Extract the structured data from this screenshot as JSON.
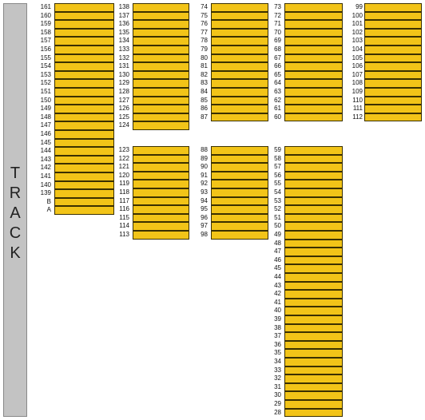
{
  "track": {
    "letters": [
      "T",
      "R",
      "A",
      "C",
      "K"
    ]
  },
  "colors": {
    "slot_fill": "#f2c418",
    "track_fill": "#c3c3c3"
  },
  "columns": [
    {
      "id": "c1a",
      "rows": [
        "161",
        "160",
        "159",
        "158",
        "157",
        "156",
        "155",
        "154",
        "153",
        "152",
        "151",
        "150",
        "149",
        "148",
        "147",
        "146",
        "145",
        "144",
        "143",
        "142",
        "141",
        "140",
        "139",
        "B",
        "A"
      ]
    },
    {
      "id": "c2a",
      "rows": [
        "138",
        "137",
        "136",
        "135",
        "134",
        "133",
        "132",
        "131",
        "130",
        "129",
        "128",
        "127",
        "126",
        "125",
        "124"
      ]
    },
    {
      "id": "c2b",
      "rows": [
        "123",
        "122",
        "121",
        "120",
        "119",
        "118",
        "117",
        "116",
        "115",
        "114",
        "113"
      ]
    },
    {
      "id": "c3a",
      "rows": [
        "74",
        "75",
        "76",
        "77",
        "78",
        "79",
        "80",
        "81",
        "82",
        "83",
        "84",
        "85",
        "86",
        "87"
      ]
    },
    {
      "id": "c3b",
      "rows": [
        "88",
        "89",
        "90",
        "91",
        "92",
        "93",
        "94",
        "95",
        "96",
        "97",
        "98"
      ]
    },
    {
      "id": "c4a",
      "rows": [
        "73",
        "72",
        "71",
        "70",
        "69",
        "68",
        "67",
        "66",
        "65",
        "64",
        "63",
        "62",
        "61",
        "60"
      ]
    },
    {
      "id": "c4b",
      "rows": [
        "59",
        "58",
        "57",
        "56",
        "55",
        "54",
        "53",
        "52",
        "51",
        "50",
        "49",
        "48",
        "47",
        "46",
        "45",
        "44",
        "43",
        "42",
        "41",
        "40",
        "39",
        "38",
        "37",
        "36",
        "35",
        "34",
        "33",
        "32",
        "31",
        "30",
        "29",
        "28"
      ]
    },
    {
      "id": "c5a",
      "rows": [
        "99",
        "100",
        "101",
        "102",
        "103",
        "104",
        "105",
        "106",
        "107",
        "108",
        "109",
        "110",
        "111",
        "112"
      ]
    }
  ]
}
